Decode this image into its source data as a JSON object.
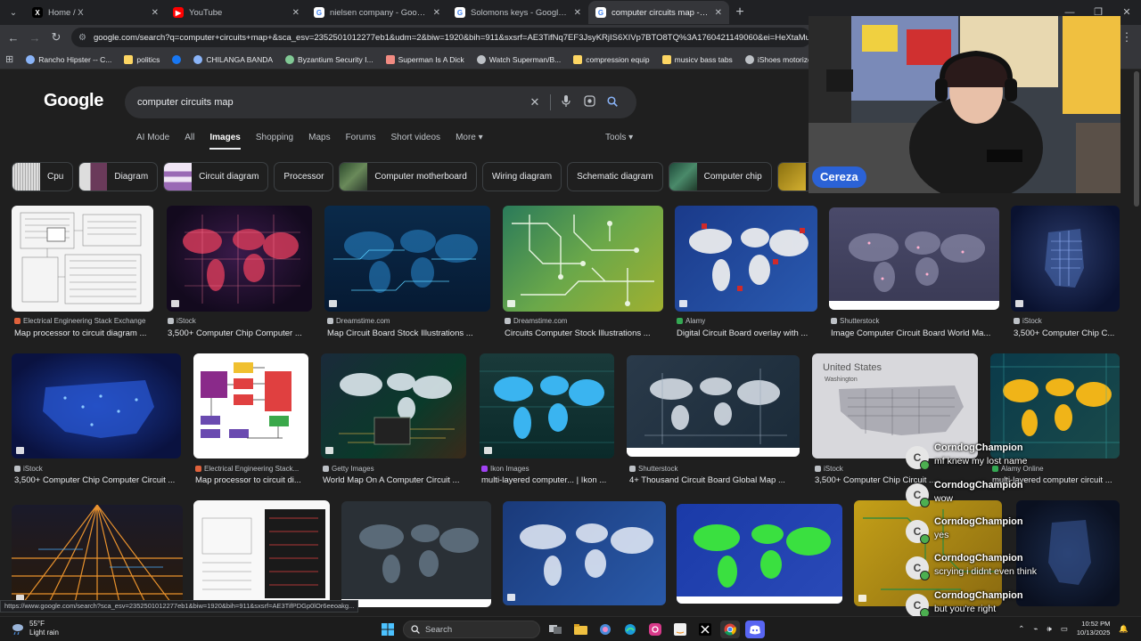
{
  "tabs": [
    {
      "title": "Home / X",
      "fav": "X",
      "fav_bg": "#000000",
      "fav_fg": "#ffffff"
    },
    {
      "title": "YouTube",
      "fav": "▶",
      "fav_bg": "#ff0000",
      "fav_fg": "#ffffff"
    },
    {
      "title": "nielsen company - Google Sear",
      "fav": "G",
      "fav_bg": "#ffffff",
      "fav_fg": "#4285f4"
    },
    {
      "title": "Solomons keys - Google Search",
      "fav": "G",
      "fav_bg": "#ffffff",
      "fav_fg": "#4285f4"
    },
    {
      "title": "computer circuits map - Google",
      "fav": "G",
      "fav_bg": "#ffffff",
      "fav_fg": "#4285f4"
    }
  ],
  "address": "google.com/search?q=computer+circuits+map+&sca_esv=2352501012277eb1&udm=2&biw=1920&bih=911&sxsrf=AE3TifNq7EF3JsyKRjIS6XIVp7BTO8TQ%3A1760421149060&ei=HeXtaMuSA",
  "bookmarks": [
    {
      "label": "Rancho Hipster -- C...",
      "color": "#8ab4f8"
    },
    {
      "label": "politics",
      "color": "#fdd663"
    },
    {
      "label": "",
      "color": "#1877f2"
    },
    {
      "label": "CHILANGA BANDA",
      "color": "#8ab4f8"
    },
    {
      "label": "Byzantium Security I...",
      "color": "#81c995"
    },
    {
      "label": "Superman Is A Dick",
      "color": "#f28b82"
    },
    {
      "label": "Watch Superman/B...",
      "color": "#bdc1c6"
    },
    {
      "label": "compression equip",
      "color": "#fdd663"
    },
    {
      "label": "musicv bass tabs",
      "color": "#fdd663"
    },
    {
      "label": "iShoes motorized sk...",
      "color": "#bdc1c6"
    }
  ],
  "google": {
    "logo": "Google",
    "query": "computer circuits map",
    "filters": [
      "AI Mode",
      "All",
      "Images",
      "Shopping",
      "Maps",
      "Forums",
      "Short videos",
      "More ▾"
    ],
    "active_filter": "Images",
    "tools": "Tools ▾",
    "chips": [
      {
        "label": "Cpu",
        "thumb": "#cccccc"
      },
      {
        "label": "Diagram",
        "thumb": "#6a4b5a"
      },
      {
        "label": "Circuit diagram",
        "thumb": "#d6c4e0"
      },
      {
        "label": "Processor",
        "thumb": ""
      },
      {
        "label": "Computer motherboard",
        "thumb": "#3a5a3a"
      },
      {
        "label": "Wiring diagram",
        "thumb": ""
      },
      {
        "label": "Schematic diagram",
        "thumb": ""
      },
      {
        "label": "Computer chip",
        "thumb": "#3a6a4a"
      },
      {
        "label": "Bo",
        "thumb": "#c4a020"
      }
    ]
  },
  "results": [
    {
      "source": "Electrical Engineering Stack Exchange",
      "title": "Map processor to circuit diagram ...",
      "icon": "#e0623c"
    },
    {
      "source": "iStock",
      "title": "3,500+ Computer Chip Computer ...",
      "icon": "#bdc1c6"
    },
    {
      "source": "Dreamstime.com",
      "title": "Map Circuit Board Stock Illustrations ...",
      "icon": "#bdc1c6"
    },
    {
      "source": "Dreamstime.com",
      "title": "Circuits Computer Stock Illustrations ...",
      "icon": "#bdc1c6"
    },
    {
      "source": "Alamy",
      "title": "Digital Circuit Board overlay with ...",
      "icon": "#34a853"
    },
    {
      "source": "Shutterstock",
      "title": "Image Computer Circuit Board World Ma...",
      "icon": "#bdc1c6"
    },
    {
      "source": "iStock",
      "title": "3,500+ Computer Chip C...",
      "icon": "#bdc1c6"
    },
    {
      "source": "iStock",
      "title": "3,500+ Computer Chip Computer Circuit ...",
      "icon": "#bdc1c6"
    },
    {
      "source": "Electrical Engineering Stack...",
      "title": "Map processor to circuit di...",
      "icon": "#e0623c"
    },
    {
      "source": "Getty Images",
      "title": "World Map On A Computer Circuit ...",
      "icon": "#bdc1c6"
    },
    {
      "source": "Ikon Images",
      "title": "multi-layered computer... | Ikon ...",
      "icon": "#a142f4"
    },
    {
      "source": "Shutterstock",
      "title": "4+ Thousand Circuit Board Global Map ...",
      "icon": "#bdc1c6"
    },
    {
      "source": "iStock",
      "title": "3,500+ Computer Chip Circuit ...",
      "icon": "#bdc1c6"
    },
    {
      "source": "Alamy Online",
      "title": "multi-layered computer circuit ...",
      "icon": "#34a853"
    }
  ],
  "thumb_texts": {
    "united_states": "United States",
    "washington": "Washington"
  },
  "status_url": "https://www.google.com/search?sca_esv=2352501012277eb1&biw=1920&bih=911&sxsrf=AE3TifPDGp0lOr6eeoakg...",
  "taskbar": {
    "temp": "55°F",
    "weather": "Light rain",
    "search": "Search",
    "time": "10:52 PM",
    "date": "10/13/2025"
  },
  "stream": {
    "name": "Cereza",
    "chat": [
      {
        "user": "CorndogChampion",
        "text": "mf knew my lost name"
      },
      {
        "user": "CorndogChampion",
        "text": "wow"
      },
      {
        "user": "CorndogChampion",
        "text": "yes"
      },
      {
        "user": "CorndogChampion",
        "text": "scrying i didnt even think"
      },
      {
        "user": "CorndogChampion",
        "text": "but you're right"
      }
    ]
  }
}
